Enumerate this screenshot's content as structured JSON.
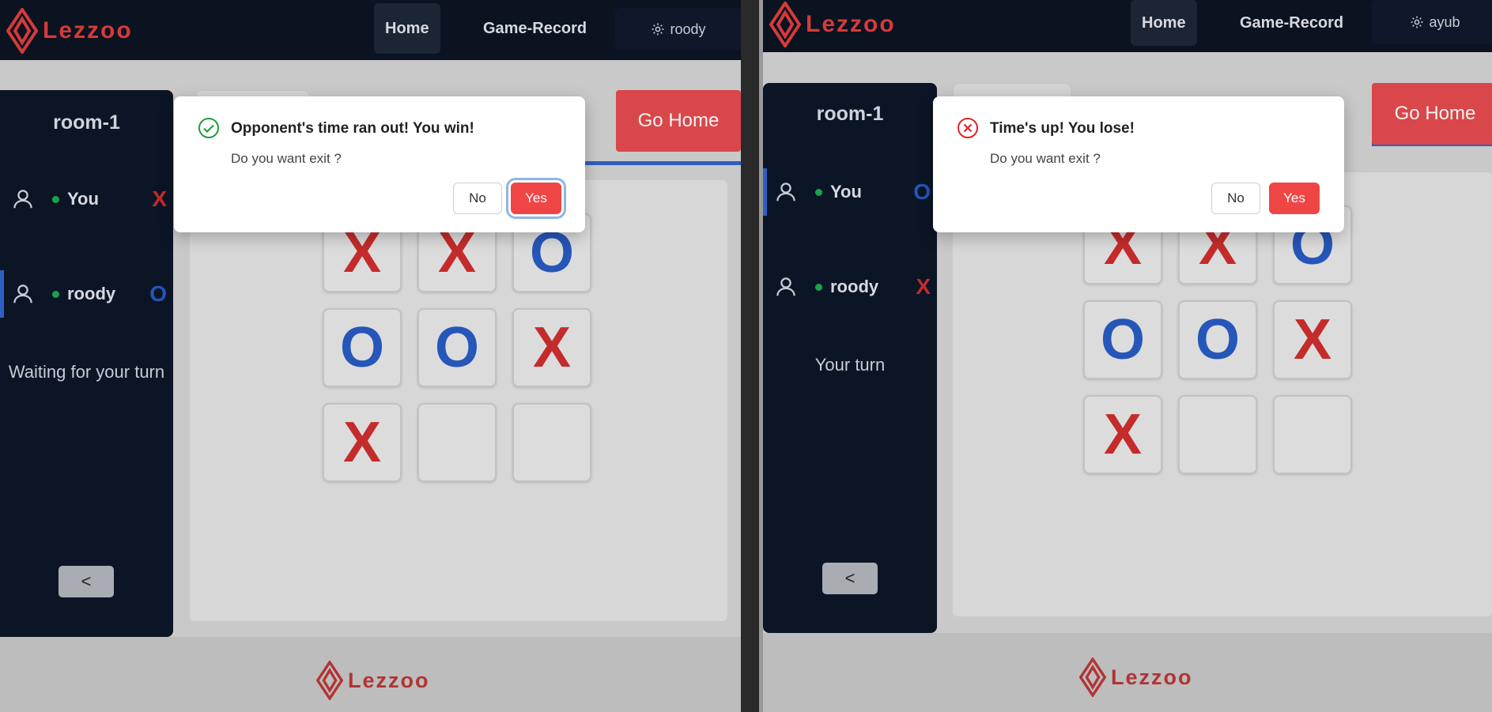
{
  "brand": {
    "name": "Lezzoo"
  },
  "nav": {
    "home": "Home",
    "record": "Game-Record"
  },
  "left": {
    "user": "roody",
    "room": "room-1",
    "players": [
      {
        "name": "You",
        "mark": "X"
      },
      {
        "name": "roody",
        "mark": "O"
      }
    ],
    "status": "Waiting for your turn",
    "back": "<",
    "go_home": "Go Home",
    "board": [
      "X",
      "X",
      "O",
      "O",
      "O",
      "X",
      "X",
      "",
      ""
    ],
    "dialog": {
      "title": "Opponent's time ran out! You win!",
      "message": "Do you want exit ?",
      "no": "No",
      "yes": "Yes"
    }
  },
  "right": {
    "user": "ayub",
    "room": "room-1",
    "players": [
      {
        "name": "You",
        "mark": "O"
      },
      {
        "name": "roody",
        "mark": "X"
      }
    ],
    "status": "Your turn",
    "back": "<",
    "go_home": "Go Home",
    "board": [
      "X",
      "X",
      "O",
      "O",
      "O",
      "X",
      "X",
      "",
      ""
    ],
    "dialog": {
      "title": "Time's up! You lose!",
      "message": "Do you want exit ?",
      "no": "No",
      "yes": "Yes"
    }
  },
  "colors": {
    "x": "#c42b2b",
    "o": "#2556b8",
    "accent": "#d9474a",
    "nav": "#0b1220"
  }
}
